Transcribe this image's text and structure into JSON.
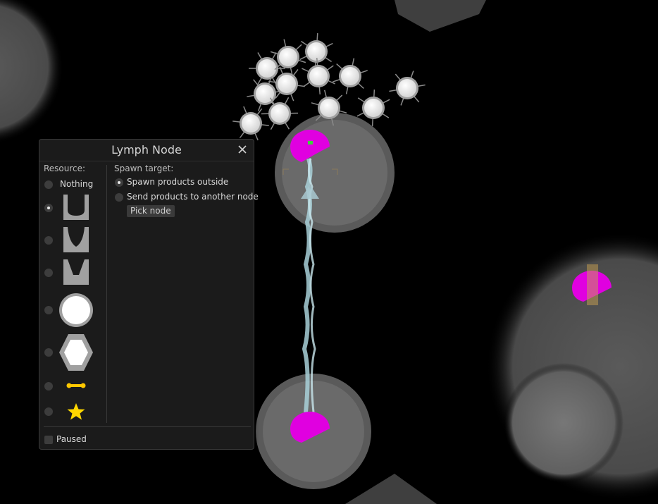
{
  "window": {
    "title": "Lymph Node",
    "close_icon": "close-icon"
  },
  "resource": {
    "label": "Resource:",
    "options": [
      {
        "label": "Nothing",
        "selected": false
      },
      {
        "icon": "cup-shape-icon",
        "selected": true
      },
      {
        "icon": "pinched-cup-icon",
        "selected": false
      },
      {
        "icon": "notched-shape-icon",
        "selected": false
      },
      {
        "icon": "white-circle-icon",
        "selected": false
      },
      {
        "icon": "hexagon-icon",
        "selected": false
      },
      {
        "icon": "yellow-bar-icon",
        "selected": false
      },
      {
        "icon": "yellow-star-icon",
        "selected": false
      }
    ]
  },
  "spawn": {
    "label": "Spawn target:",
    "option_outside": "Spawn products outside",
    "option_node": "Send products to another node",
    "pick_node": "Pick node",
    "selected": "outside"
  },
  "paused": {
    "label": "Paused",
    "checked": false
  },
  "colors": {
    "panel_bg": "#1b1b1b",
    "node_magenta": "#e000e0",
    "link_cyan": "#a8d0d8",
    "star_yellow": "#ffd700"
  }
}
